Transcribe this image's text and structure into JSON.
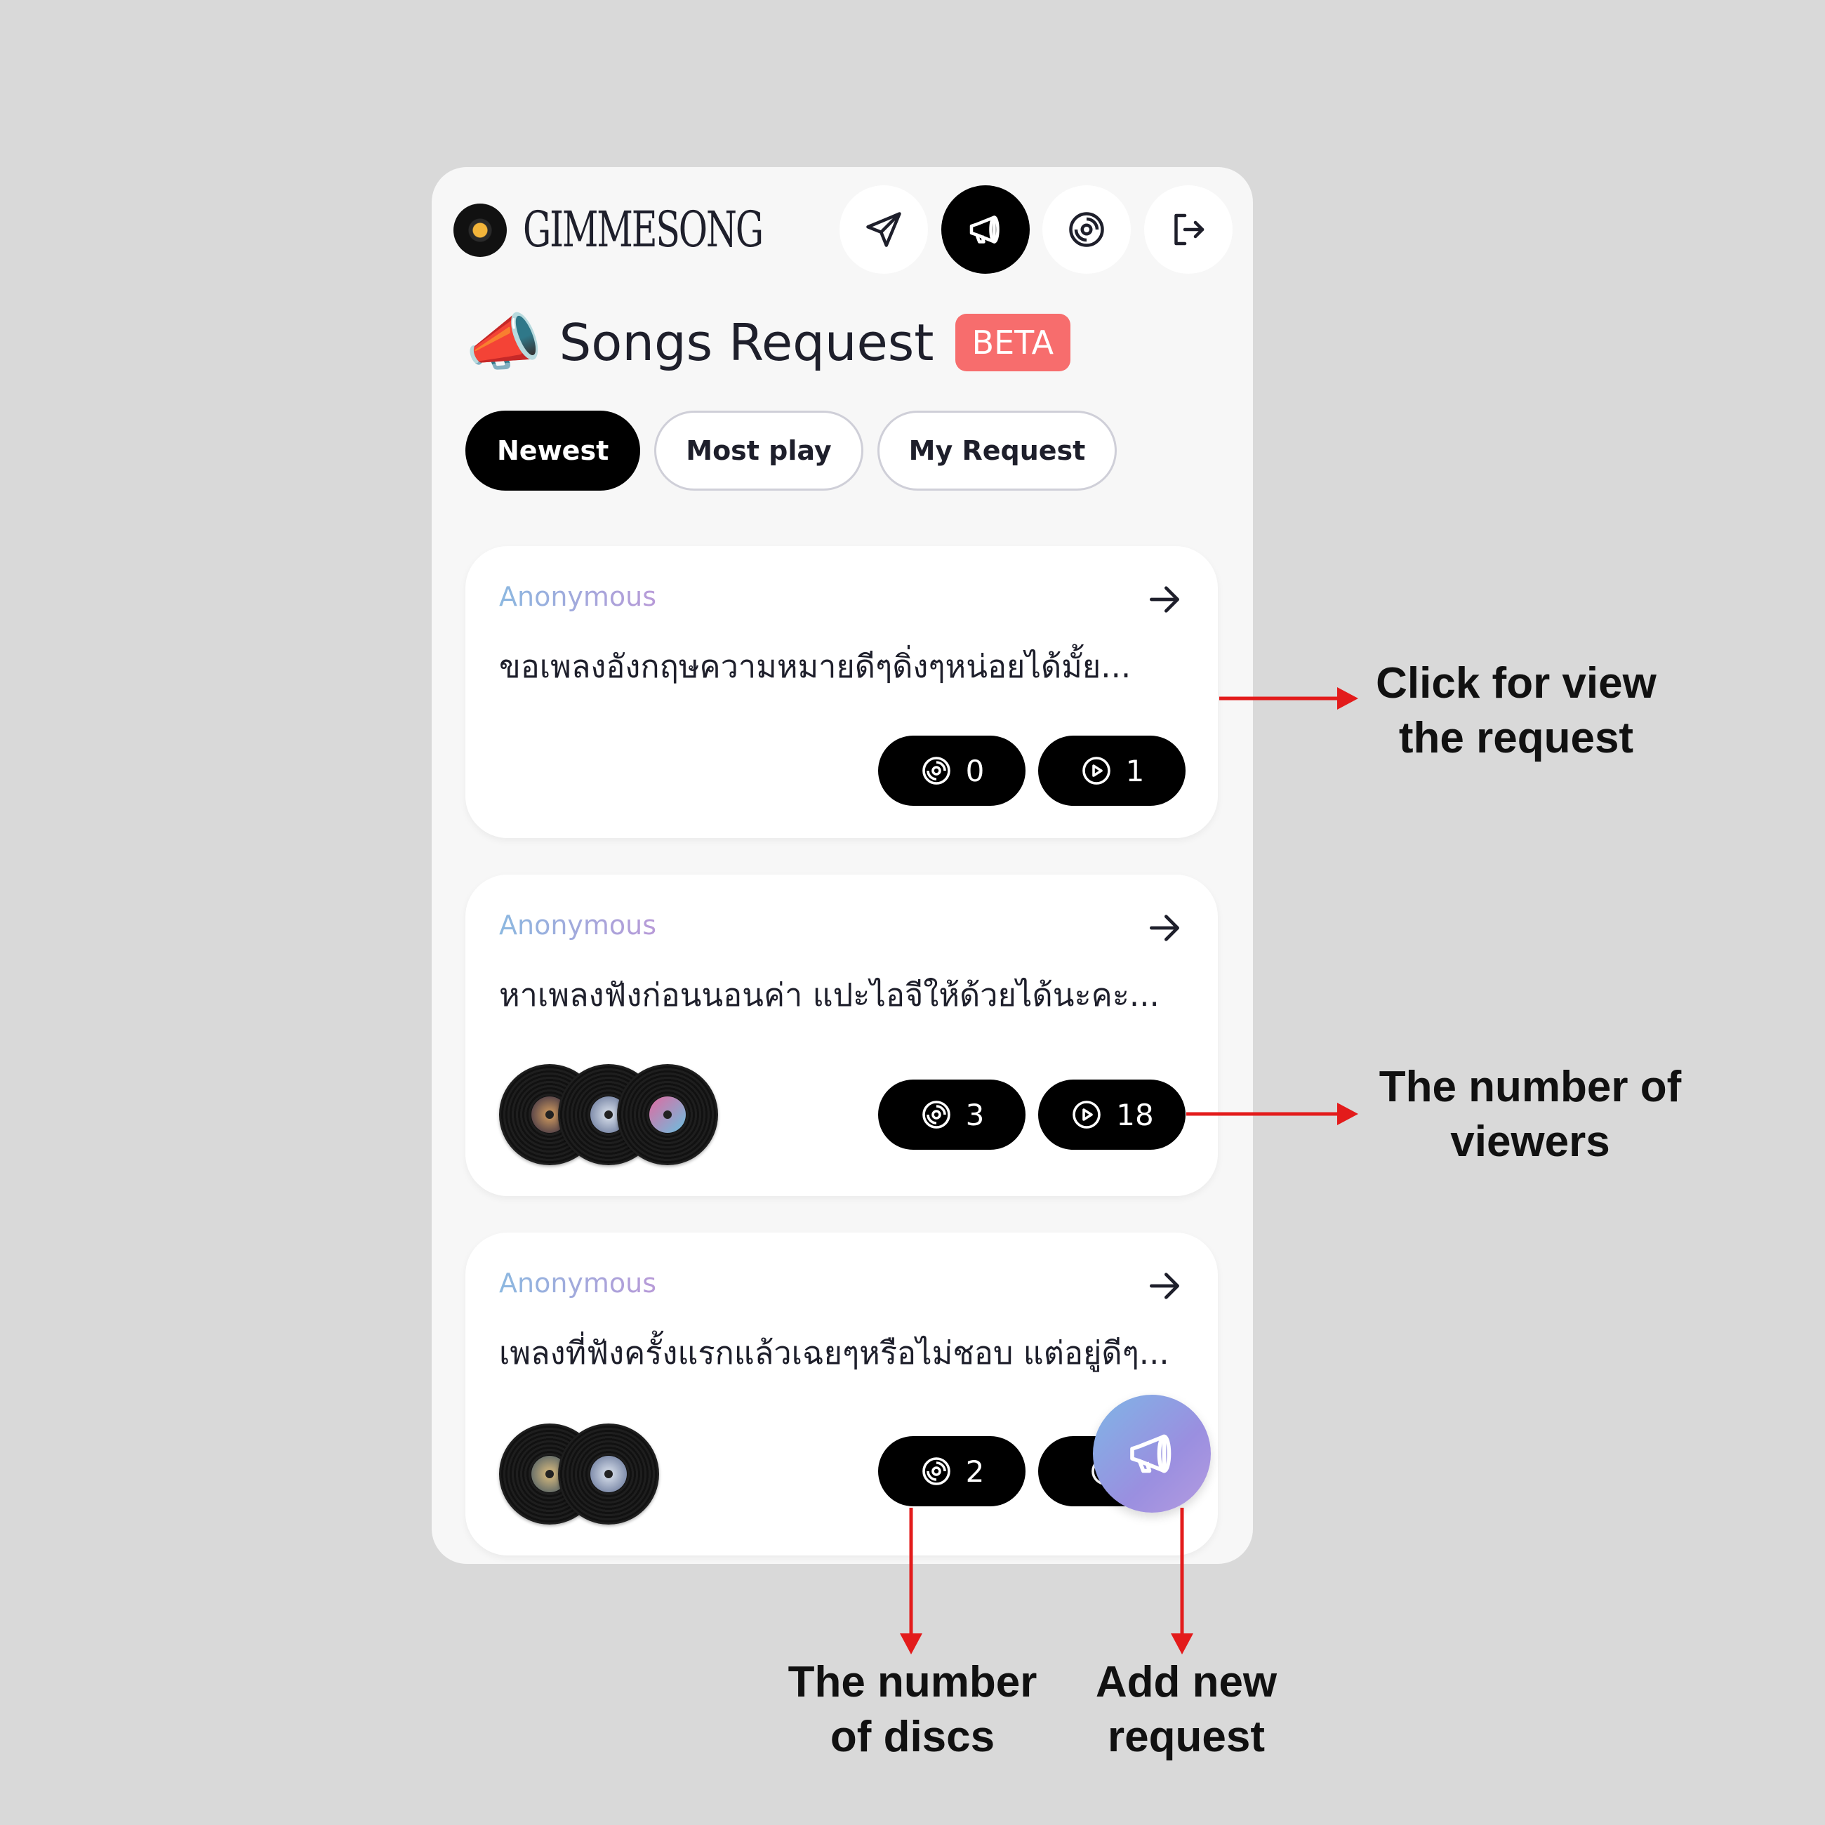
{
  "app": {
    "logo_text": "GIMMESONG",
    "nav": [
      {
        "icon": "send-icon"
      },
      {
        "icon": "megaphone-icon"
      },
      {
        "icon": "disc-icon"
      },
      {
        "icon": "logout-icon"
      }
    ]
  },
  "page": {
    "emoji": "📣",
    "title": "Songs Request",
    "badge": "BETA"
  },
  "tabs": [
    {
      "label": "Newest",
      "active": true
    },
    {
      "label": "Most play",
      "active": false
    },
    {
      "label": "My Request",
      "active": false
    }
  ],
  "requests": [
    {
      "author": "Anonymous",
      "message": "ขอเพลงอังกฤษความหมายดีๆดิ่งๆหน่อยได้มั้ย...",
      "discs": "0",
      "views": "1"
    },
    {
      "author": "Anonymous",
      "message": "หาเพลงฟังก่อนนอนค่า แปะไอจีให้ด้วยได้นะคะ...",
      "discs": "3",
      "views": "18"
    },
    {
      "author": "Anonymous",
      "message": "เพลงที่ฟังครั้งแรกแล้วเฉยๆหรือไม่ชอบ แต่อยู่ดีๆ...",
      "discs": "2",
      "views": ""
    }
  ],
  "annotations": {
    "view_request": "Click for view the request",
    "viewers": "The number of viewers",
    "discs": "The number of discs",
    "add_new": "Add new request"
  },
  "colors": {
    "accent": "#000000",
    "beta_badge": "#f76d6d",
    "annotation_arrow": "#e31b1b",
    "fab_gradient_start": "#7fb5e6",
    "fab_gradient_end": "#b49be0"
  }
}
